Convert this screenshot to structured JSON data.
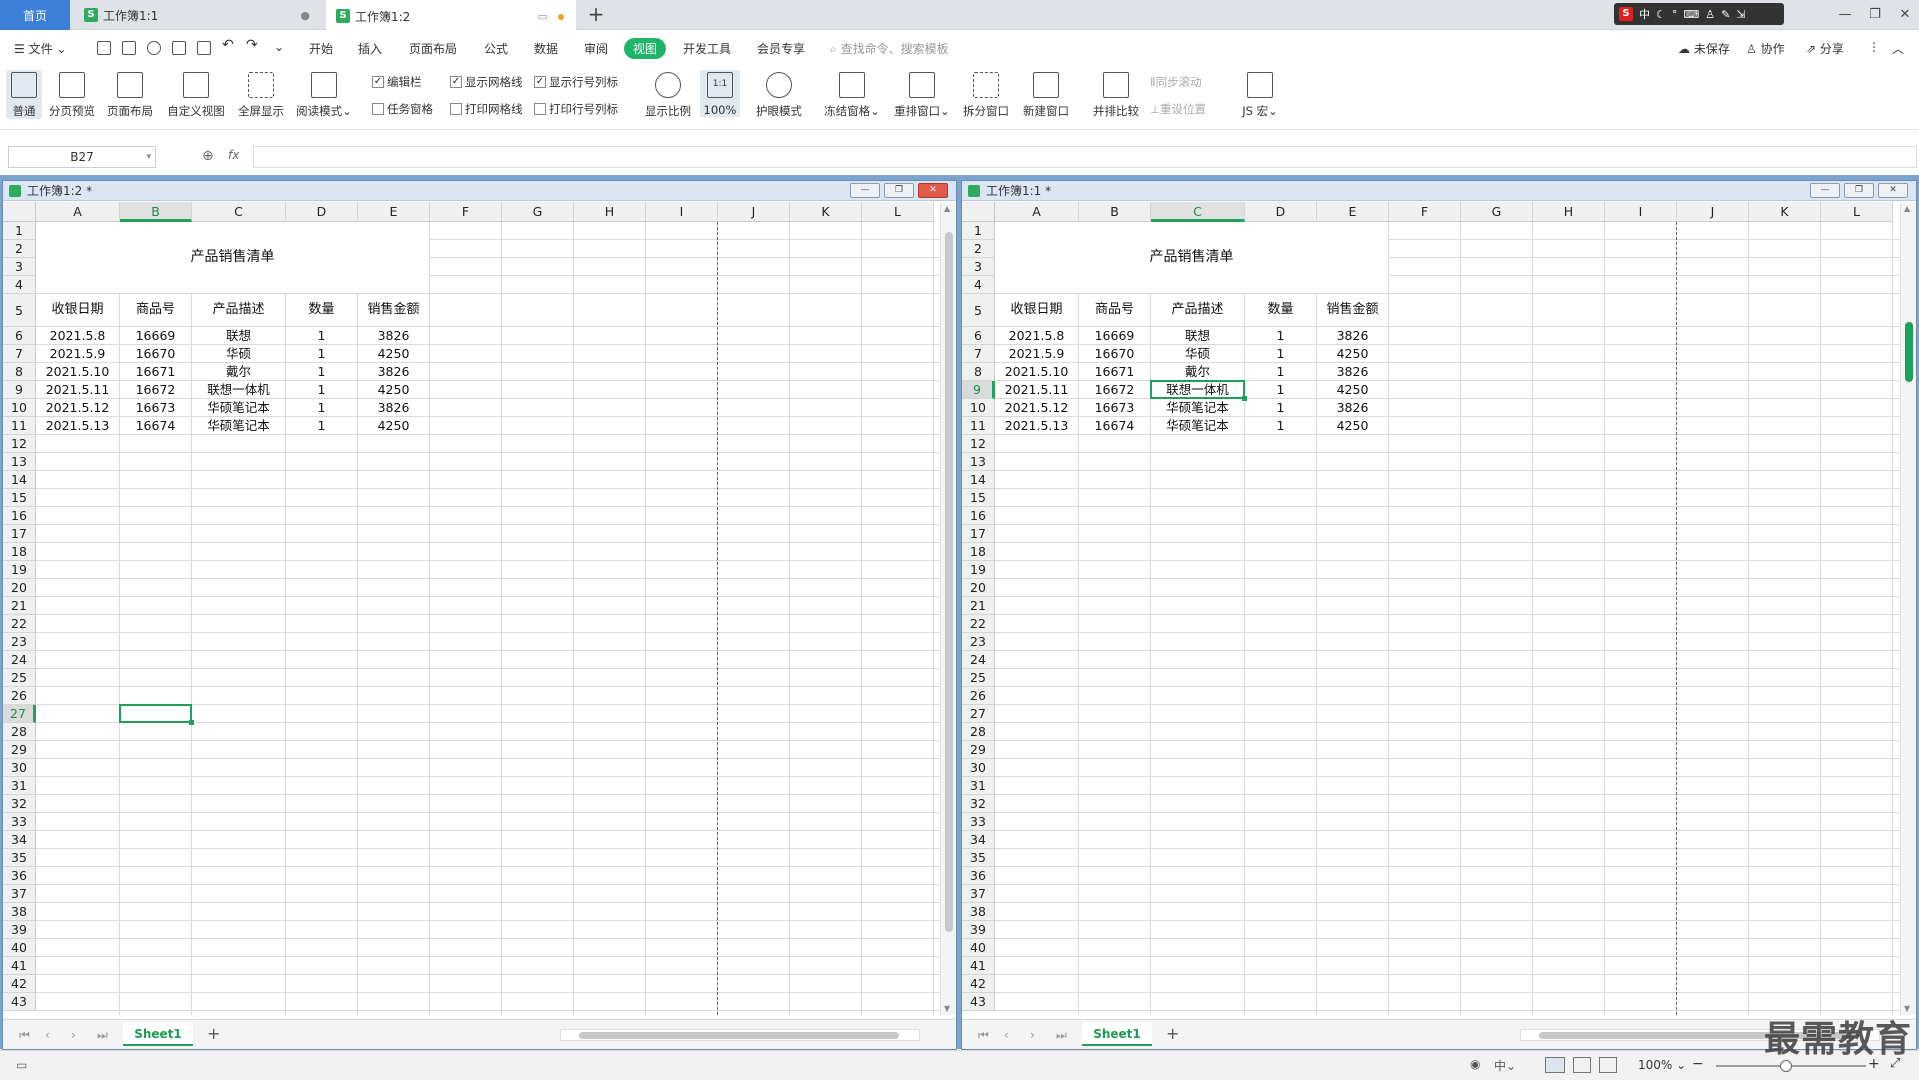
{
  "tabs": {
    "home": "首页",
    "doc1": "工作簿1:1",
    "doc2": "工作簿1:2",
    "new_tab": "+"
  },
  "ime_bar": {
    "logo": "S",
    "lang": "中"
  },
  "menu": {
    "file": "文件",
    "items": [
      "开始",
      "插入",
      "页面布局",
      "公式",
      "数据",
      "审阅",
      "视图",
      "开发工具",
      "会员专享"
    ],
    "active": "视图",
    "search_placeholder": "查找命令、搜索模板",
    "unsaved": "未保存",
    "collab": "协作",
    "share": "分享"
  },
  "ribbon": {
    "normal": "普通",
    "page_preview": "分页预览",
    "page_layout": "页面布局",
    "custom_view": "自定义视图",
    "fullscreen": "全屏显示",
    "reading_mode": "阅读模式",
    "edit_bar": "编辑栏",
    "task_pane": "任务窗格",
    "show_gridlines": "显示网格线",
    "print_gridlines": "打印网格线",
    "show_headers": "显示行号列标",
    "print_headers": "打印行号列标",
    "zoom_ratio": "显示比例",
    "zoom_100": "100%",
    "zoom_100_icon": "1:1",
    "eye_mode": "护眼模式",
    "freeze": "冻结窗格",
    "rearrange": "重排窗口",
    "split": "拆分窗口",
    "new_window": "新建窗口",
    "side_by_side": "并排比较",
    "sync_scroll": "同步滚动",
    "reset_pos": "重设位置",
    "macro": "JS 宏"
  },
  "formula_bar": {
    "name_box": "B27",
    "fx": "fx",
    "value": ""
  },
  "columns": [
    "A",
    "B",
    "C",
    "D",
    "E",
    "F",
    "G",
    "H",
    "I",
    "J",
    "K",
    "L"
  ],
  "rows": [
    "1",
    "2",
    "3",
    "4",
    "5",
    "6",
    "7",
    "8",
    "9",
    "10",
    "11",
    "12",
    "13",
    "14",
    "15",
    "16",
    "17",
    "18",
    "19",
    "20",
    "21",
    "22",
    "23",
    "24",
    "25",
    "26",
    "27",
    "28",
    "29",
    "30",
    "31",
    "32",
    "33",
    "34",
    "35",
    "36",
    "37",
    "38",
    "39",
    "40",
    "41",
    "42",
    "43"
  ],
  "sheet": {
    "title": "产品销售清单",
    "headers": [
      "收银日期",
      "商品号",
      "产品描述",
      "数量",
      "销售金额"
    ],
    "rows": [
      [
        "2021.5.8",
        "16669",
        "联想",
        "1",
        "3826"
      ],
      [
        "2021.5.9",
        "16670",
        "华硕",
        "1",
        "4250"
      ],
      [
        "2021.5.10",
        "16671",
        "戴尔",
        "1",
        "3826"
      ],
      [
        "2021.5.11",
        "16672",
        "联想一体机",
        "1",
        "4250"
      ],
      [
        "2021.5.12",
        "16673",
        "华硕笔记本",
        "1",
        "3826"
      ],
      [
        "2021.5.13",
        "16674",
        "华硕笔记本",
        "1",
        "4250"
      ]
    ]
  },
  "panes": [
    {
      "title": "工作簿1:2 *",
      "active_cell": "B27",
      "active_col": "B",
      "active_row": "27"
    },
    {
      "title": "工作簿1:1 *",
      "active_cell": "C9",
      "active_col": "C",
      "active_row": "9"
    }
  ],
  "sheet_tab": "Sheet1",
  "status": {
    "zoom": "100%"
  },
  "watermark": "最需教育",
  "colors": {
    "accent": "#1fb46a",
    "home_tab": "#3c7fd8",
    "selection": "#1fa05a"
  }
}
